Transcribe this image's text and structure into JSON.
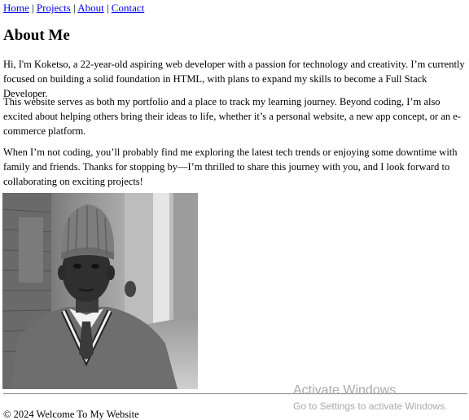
{
  "nav": {
    "home": "Home",
    "projects": "Projects",
    "about": "About",
    "contact": "Contact",
    "separator": "|"
  },
  "heading": "About Me",
  "paragraphs": [
    "Hi, I'm Koketso, a 22-year-old aspiring web developer with a passion for technology and creativity. I’m currently focused on building a solid foundation in HTML, with plans to expand my skills to become a Full Stack Developer.",
    "This website serves as both my portfolio and a place to track my learning journey. Beyond coding, I’m also excited about helping others bring their ideas to life, whether it’s a personal website, a new app concept, or an e-commerce platform.",
    "When I’m not coding, you’ll probably find me exploring the latest tech trends or enjoying some downtime with family and friends. Thanks for stopping by—I’m thrilled to share this journey with you, and I look forward to collaborating on exciting projects!"
  ],
  "footer": "© 2024 Welcome To My Website",
  "watermark": {
    "line1": "Activate Windows",
    "line2": "Go to Settings to activate Windows."
  },
  "colors": {
    "link": "#0000ee",
    "watermark": "#a9a9a9"
  }
}
